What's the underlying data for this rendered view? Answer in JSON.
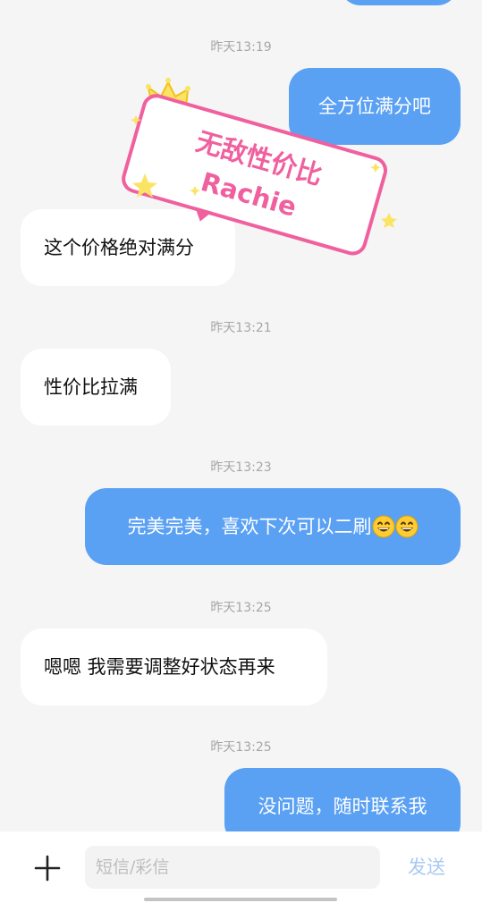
{
  "messages": [
    {
      "type": "timestamp",
      "text": "昨天13:19"
    },
    {
      "type": "out",
      "text": "全方位满分吧"
    },
    {
      "type": "in",
      "text": "这个价格绝对满分"
    },
    {
      "type": "timestamp",
      "text": "昨天13:21"
    },
    {
      "type": "in",
      "text": "性价比拉满"
    },
    {
      "type": "timestamp",
      "text": "昨天13:23"
    },
    {
      "type": "out",
      "text": "完美完美，喜欢下次可以二刷"
    },
    {
      "type": "timestamp",
      "text": "昨天13:25"
    },
    {
      "type": "in",
      "text": "嗯嗯 我需要调整好状态再来"
    },
    {
      "type": "timestamp",
      "text": "昨天13:25"
    },
    {
      "type": "out",
      "text": "没问题，随时联系我"
    }
  ],
  "sticker": {
    "line1": "无敌性价比",
    "line2": "Rachie"
  },
  "emoji": [
    "grinning-face-icon",
    "grinning-face-icon"
  ],
  "composer": {
    "placeholder": "短信/彩信",
    "send_label": "发送"
  },
  "colors": {
    "background": "#f5f5f5",
    "outgoing_bubble": "#5aa0f3",
    "incoming_bubble": "#ffffff",
    "sticker_pink": "#f0609e",
    "send_disabled": "#aac9f3"
  }
}
